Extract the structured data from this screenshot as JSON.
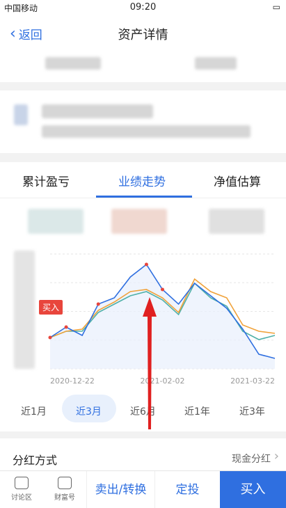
{
  "status": {
    "carrier": "中国移动",
    "time": "09:20",
    "battery": ""
  },
  "nav": {
    "back_label": "返回",
    "title": "资产详情"
  },
  "tabs": [
    "累计盈亏",
    "业绩走势",
    "净值估算"
  ],
  "active_tab": 1,
  "chart_data": {
    "type": "line",
    "x_labels": [
      "2020-12-22",
      "2021-02-02",
      "2021-03-22"
    ],
    "series": [
      {
        "color": "#2f6fe0",
        "values": [
          0.0,
          0.5,
          0.1,
          1.6,
          1.9,
          2.9,
          3.5,
          2.3,
          1.6,
          2.6,
          2.0,
          1.4,
          0.4,
          -0.8,
          -1.0
        ]
      },
      {
        "color": "#f0a23a",
        "values": [
          0.0,
          0.3,
          0.4,
          1.3,
          1.7,
          2.2,
          2.3,
          1.9,
          1.2,
          2.8,
          2.2,
          1.9,
          0.6,
          0.3,
          0.2
        ]
      },
      {
        "color": "#4fb0a8",
        "values": [
          0.0,
          0.3,
          0.3,
          1.2,
          1.6,
          2.0,
          2.2,
          1.8,
          1.1,
          2.6,
          1.9,
          1.5,
          0.3,
          -0.1,
          0.1
        ]
      }
    ],
    "markers": "buy points",
    "buy_label": "买入"
  },
  "ranges": [
    "近1月",
    "近3月",
    "近6月",
    "近1年",
    "近3年"
  ],
  "active_range": 1,
  "dividend": {
    "label": "分红方式",
    "value": "现金分红"
  },
  "bottom": {
    "forum": "讨论区",
    "fortune": "财富号",
    "sell": "卖出/转换",
    "fixed": "定投",
    "buy": "买入"
  },
  "colors": {
    "accent": "#2f6fe0",
    "buy_tag": "#e8453c",
    "arrow": "#e02020"
  }
}
